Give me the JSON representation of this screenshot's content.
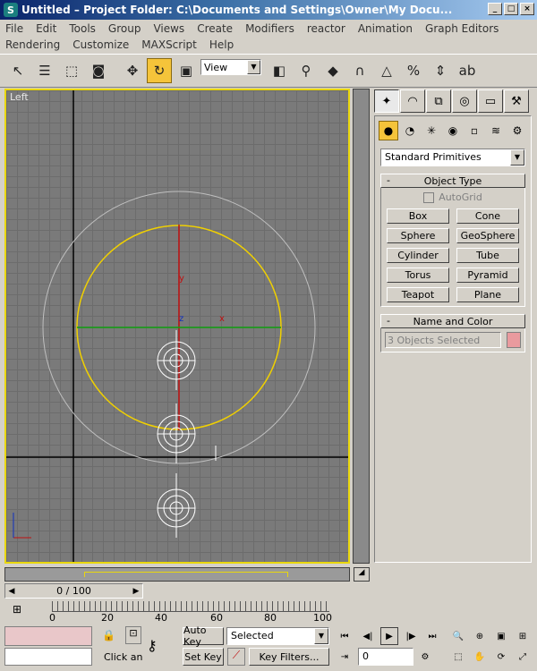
{
  "window": {
    "title": "Untitled     – Project Folder: C:\\Documents and Settings\\Owner\\My Docu...",
    "app_icon": "S"
  },
  "menu": {
    "row1": [
      "File",
      "Edit",
      "Tools",
      "Group",
      "Views",
      "Create",
      "Modifiers",
      "reactor",
      "Animation",
      "Graph Editors"
    ],
    "row2": [
      "Rendering",
      "Customize",
      "MAXScript",
      "Help"
    ]
  },
  "toolbar": {
    "view_dropdown": "View"
  },
  "viewport": {
    "label": "Left",
    "axis_labels": {
      "z": "z",
      "x": "x",
      "y": "y"
    }
  },
  "command_panel": {
    "category_dropdown": "Standard Primitives",
    "object_type_title": "Object Type",
    "autogrid_label": "AutoGrid",
    "buttons": [
      "Box",
      "Cone",
      "Sphere",
      "GeoSphere",
      "Cylinder",
      "Tube",
      "Torus",
      "Pyramid",
      "Teapot",
      "Plane"
    ],
    "name_color_title": "Name and Color",
    "name_field": "3 Objects Selected",
    "swatch_color": "#e99a9e"
  },
  "timeline": {
    "slider_value": "0 / 100",
    "ticks": [
      "0",
      "20",
      "40",
      "60",
      "80",
      "100"
    ]
  },
  "bottom": {
    "click_hint": "Click an",
    "auto_key": "Auto Key",
    "set_key": "Set Key",
    "selected_dropdown": "Selected",
    "key_filters": "Key Filters...",
    "frame_value": "0"
  }
}
